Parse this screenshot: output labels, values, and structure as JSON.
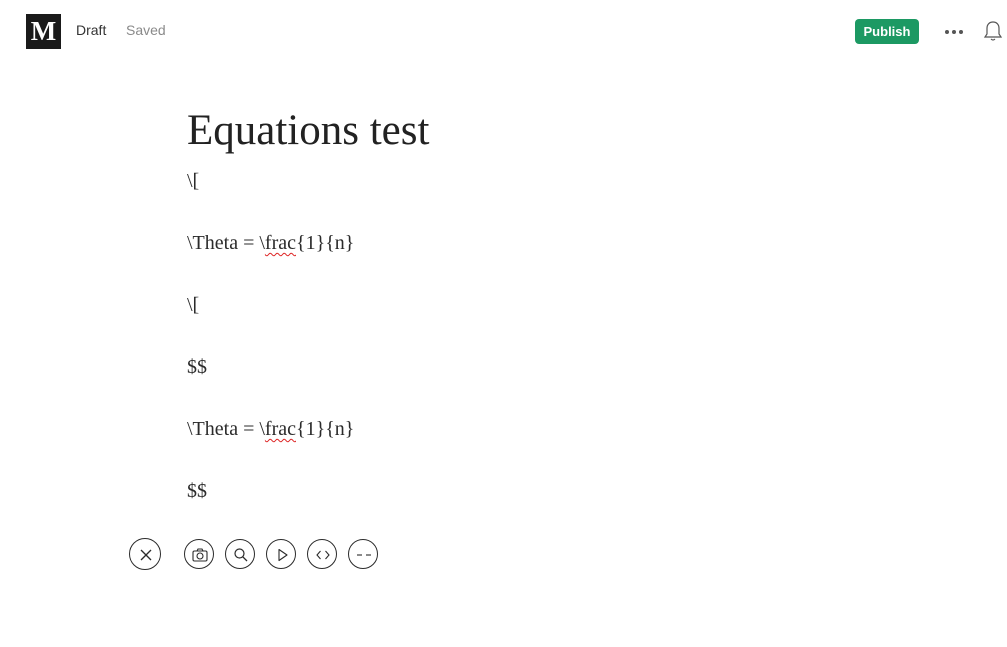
{
  "topbar": {
    "logo_letter": "M",
    "draft_label": "Draft",
    "saved_label": "Saved",
    "publish_label": "Publish",
    "more_icon": "more-horizontal-icon",
    "bell_icon": "bell-icon",
    "publish_color": "#1c9963"
  },
  "post": {
    "title": "Equations test",
    "paragraphs": [
      {
        "text": "\\["
      },
      {
        "before": "\\Theta = \\",
        "misspelled": "frac",
        "after": "{1}{n}"
      },
      {
        "text": "\\["
      },
      {
        "text": "$$"
      },
      {
        "before": "\\Theta = \\",
        "misspelled": "frac",
        "after": "{1}{n}"
      },
      {
        "text": "$$"
      }
    ]
  },
  "insert_toolbar": {
    "close_icon": "close-icon",
    "items": [
      {
        "icon": "camera-icon",
        "label": "image"
      },
      {
        "icon": "search-icon",
        "label": "unsplash"
      },
      {
        "icon": "play-icon",
        "label": "video"
      },
      {
        "icon": "code-icon",
        "label": "embed"
      },
      {
        "icon": "dashes-icon",
        "label": "section-break"
      }
    ]
  }
}
